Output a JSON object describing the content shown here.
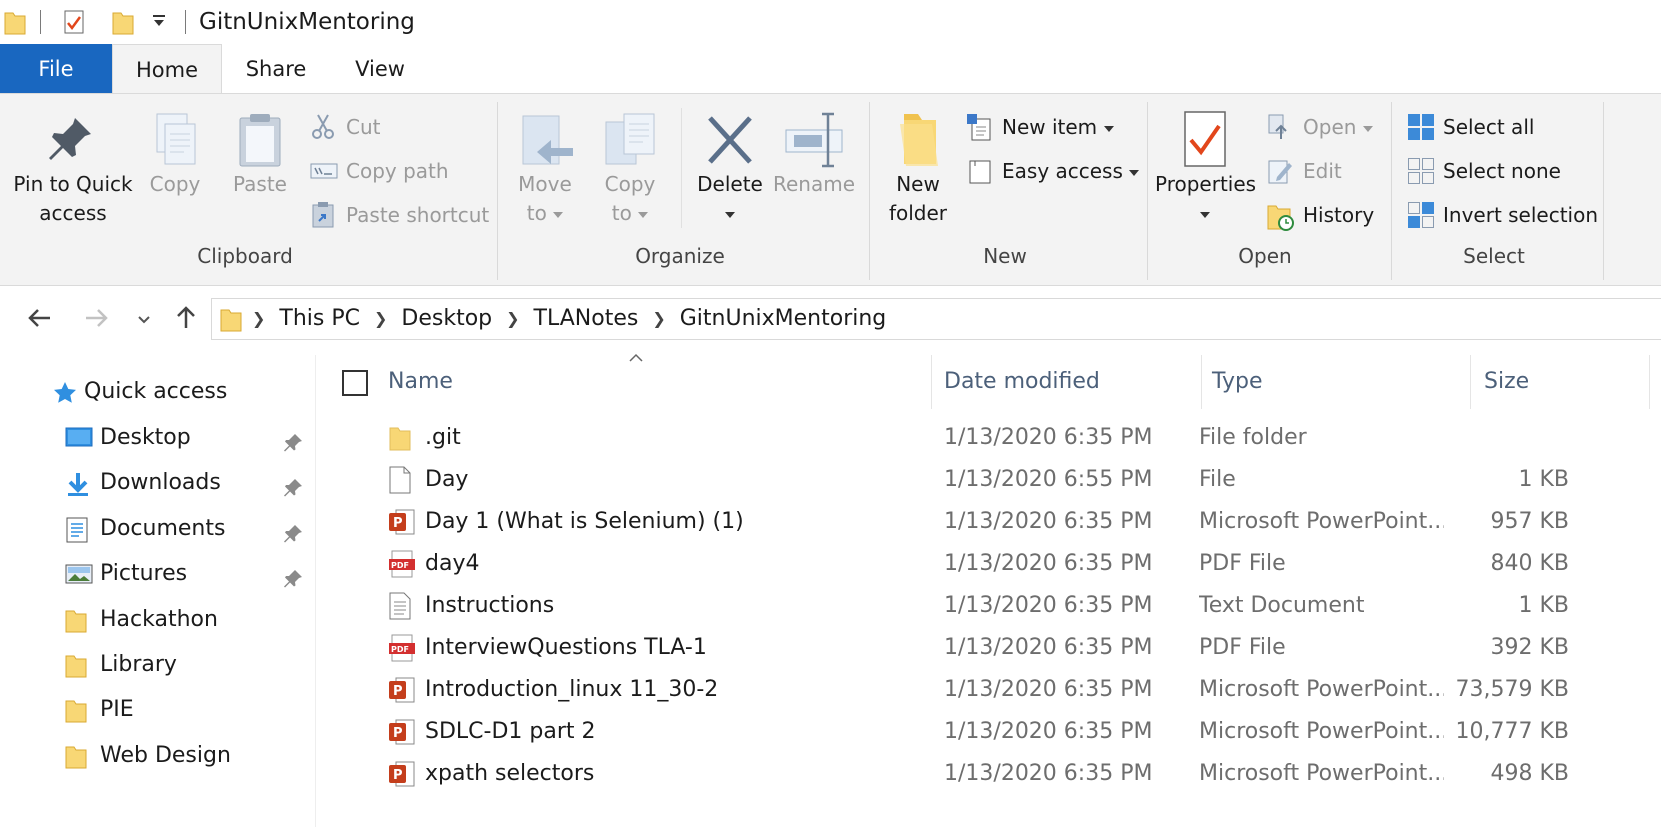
{
  "window": {
    "title": "GitnUnixMentoring"
  },
  "tabs": {
    "file": "File",
    "home": "Home",
    "share": "Share",
    "view": "View"
  },
  "ribbon": {
    "clipboard": {
      "group_label": "Clipboard",
      "pin_line1": "Pin to Quick",
      "pin_line2": "access",
      "copy": "Copy",
      "paste": "Paste",
      "cut": "Cut",
      "copy_path": "Copy path",
      "paste_shortcut": "Paste shortcut"
    },
    "organize": {
      "group_label": "Organize",
      "move_line1": "Move",
      "move_line2": "to",
      "copy_line1": "Copy",
      "copy_line2": "to",
      "delete": "Delete",
      "rename": "Rename"
    },
    "new": {
      "group_label": "New",
      "new_folder_line1": "New",
      "new_folder_line2": "folder",
      "new_item": "New item",
      "easy_access": "Easy access"
    },
    "open": {
      "group_label": "Open",
      "properties": "Properties",
      "open": "Open",
      "edit": "Edit",
      "history": "History"
    },
    "select": {
      "group_label": "Select",
      "select_all": "Select all",
      "select_none": "Select none",
      "invert_selection": "Invert selection"
    }
  },
  "breadcrumb": [
    "This PC",
    "Desktop",
    "TLANotes",
    "GitnUnixMentoring"
  ],
  "nav": {
    "quick_access": "Quick access",
    "items": [
      {
        "label": "Desktop",
        "icon": "desktop-icon",
        "pinned": true
      },
      {
        "label": "Downloads",
        "icon": "downloads-icon",
        "pinned": true
      },
      {
        "label": "Documents",
        "icon": "documents-icon",
        "pinned": true
      },
      {
        "label": "Pictures",
        "icon": "pictures-icon",
        "pinned": true
      },
      {
        "label": "Hackathon",
        "icon": "folder-icon",
        "pinned": false
      },
      {
        "label": "Library",
        "icon": "folder-icon",
        "pinned": false
      },
      {
        "label": "PIE",
        "icon": "folder-icon",
        "pinned": false
      },
      {
        "label": "Web Design",
        "icon": "folder-icon",
        "pinned": false
      }
    ]
  },
  "columns": {
    "name": "Name",
    "date": "Date modified",
    "type": "Type",
    "size": "Size"
  },
  "files": [
    {
      "name": ".git",
      "date": "1/13/2020 6:35 PM",
      "type": "File folder",
      "size": "",
      "icon": "folder-icon"
    },
    {
      "name": "Day",
      "date": "1/13/2020 6:55 PM",
      "type": "File",
      "size": "1 KB",
      "icon": "blank-file-icon"
    },
    {
      "name": "Day 1 (What is Selenium) (1)",
      "date": "1/13/2020 6:35 PM",
      "type": "Microsoft PowerPoint...",
      "size": "957 KB",
      "icon": "powerpoint-icon"
    },
    {
      "name": "day4",
      "date": "1/13/2020 6:35 PM",
      "type": "PDF File",
      "size": "840 KB",
      "icon": "pdf-icon"
    },
    {
      "name": "Instructions",
      "date": "1/13/2020 6:35 PM",
      "type": "Text Document",
      "size": "1 KB",
      "icon": "text-file-icon"
    },
    {
      "name": "InterviewQuestions TLA-1",
      "date": "1/13/2020 6:35 PM",
      "type": "PDF File",
      "size": "392 KB",
      "icon": "pdf-icon"
    },
    {
      "name": "Introduction_linux 11_30-2",
      "date": "1/13/2020 6:35 PM",
      "type": "Microsoft PowerPoint...",
      "size": "73,579 KB",
      "icon": "powerpoint-icon"
    },
    {
      "name": "SDLC-D1 part 2",
      "date": "1/13/2020 6:35 PM",
      "type": "Microsoft PowerPoint...",
      "size": "10,777 KB",
      "icon": "powerpoint-icon"
    },
    {
      "name": "xpath selectors",
      "date": "1/13/2020 6:35 PM",
      "type": "Microsoft PowerPoint...",
      "size": "498 KB",
      "icon": "powerpoint-icon"
    }
  ],
  "colors": {
    "accent": "#1967c0",
    "folder": "#f8d775",
    "pdf": "#d32f2f",
    "powerpoint": "#c43e1c"
  }
}
